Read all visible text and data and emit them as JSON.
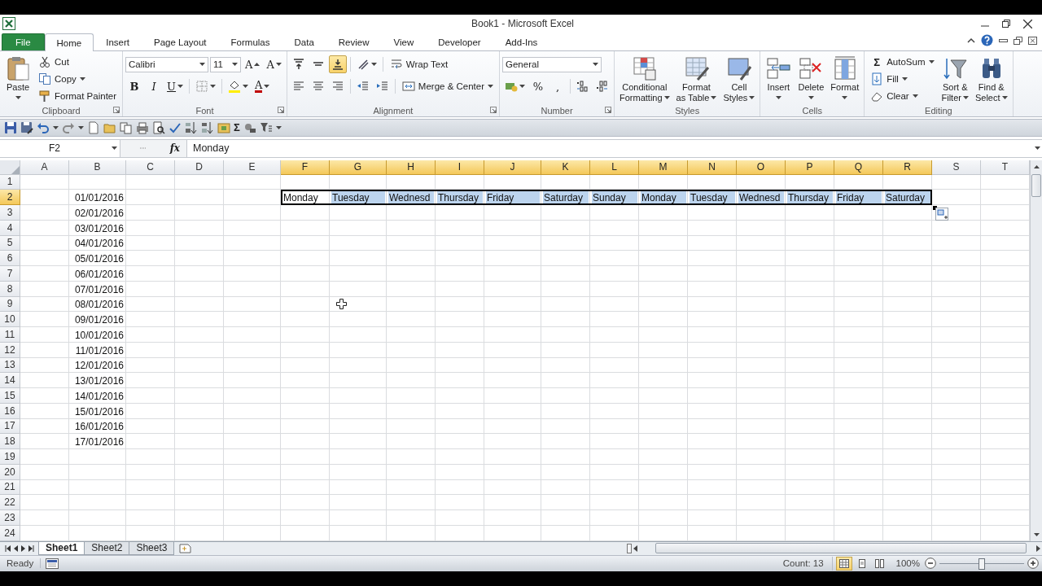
{
  "window": {
    "title": "Book1 - Microsoft Excel"
  },
  "tabs": [
    {
      "label": "File",
      "kind": "file",
      "selected": false
    },
    {
      "label": "Home",
      "kind": "tab",
      "selected": true
    },
    {
      "label": "Insert",
      "kind": "tab",
      "selected": false
    },
    {
      "label": "Page Layout",
      "kind": "tab",
      "selected": false
    },
    {
      "label": "Formulas",
      "kind": "tab",
      "selected": false
    },
    {
      "label": "Data",
      "kind": "tab",
      "selected": false
    },
    {
      "label": "Review",
      "kind": "tab",
      "selected": false
    },
    {
      "label": "View",
      "kind": "tab",
      "selected": false
    },
    {
      "label": "Developer",
      "kind": "tab",
      "selected": false
    },
    {
      "label": "Add-Ins",
      "kind": "tab",
      "selected": false
    }
  ],
  "ribbon": {
    "groups": [
      {
        "label": "Clipboard",
        "launcher": true,
        "items": [
          {
            "kind": "large",
            "lines": [
              "Paste"
            ],
            "dropdown": true
          },
          {
            "kind": "stack",
            "items": [
              {
                "kind": "small",
                "label": "Cut",
                "dropdown": false
              },
              {
                "kind": "small",
                "label": "Copy",
                "dropdown": true
              },
              {
                "kind": "small",
                "label": "Format Painter",
                "dropdown": false
              }
            ]
          }
        ]
      },
      {
        "label": "Font",
        "launcher": true,
        "items": [
          {
            "kind": "rows",
            "rows": [
              {
                "items": [
                  {
                    "kind": "combo",
                    "value": "Calibri"
                  },
                  {
                    "kind": "combo",
                    "value": "11"
                  },
                  {
                    "kind": "tool",
                    "text": "A",
                    "dropdown": false
                  },
                  {
                    "kind": "tool",
                    "text": "A",
                    "dropdown": false
                  }
                ]
              },
              {
                "items": [
                  {
                    "kind": "tool",
                    "text": "B",
                    "dropdown": false
                  },
                  {
                    "kind": "tool",
                    "text": "I",
                    "dropdown": false
                  },
                  {
                    "kind": "tool",
                    "text": "U",
                    "dropdown": true
                  },
                  {
                    "kind": "separator"
                  },
                  {
                    "kind": "tool",
                    "dropdown": true
                  },
                  {
                    "kind": "separator"
                  },
                  {
                    "kind": "tool",
                    "dropdown": true
                  },
                  {
                    "kind": "tool",
                    "text": "A",
                    "dropdown": true
                  }
                ]
              }
            ]
          }
        ]
      },
      {
        "label": "Alignment",
        "launcher": true,
        "items": [
          {
            "kind": "rows",
            "rows": [
              {
                "items": [
                  {
                    "kind": "tool",
                    "dropdown": false,
                    "selected": false
                  },
                  {
                    "kind": "tool",
                    "dropdown": false,
                    "selected": false
                  },
                  {
                    "kind": "tool",
                    "dropdown": false,
                    "selected": true
                  },
                  {
                    "kind": "separator"
                  },
                  {
                    "kind": "tool",
                    "dropdown": true
                  },
                  {
                    "kind": "separator"
                  },
                  {
                    "kind": "small",
                    "label": "Wrap Text",
                    "dropdown": false
                  }
                ]
              },
              {
                "items": [
                  {
                    "kind": "tool",
                    "dropdown": false
                  },
                  {
                    "kind": "tool",
                    "dropdown": false
                  },
                  {
                    "kind": "tool",
                    "dropdown": false
                  },
                  {
                    "kind": "separator"
                  },
                  {
                    "kind": "tool",
                    "dropdown": false
                  },
                  {
                    "kind": "tool",
                    "dropdown": false
                  },
                  {
                    "kind": "separator"
                  },
                  {
                    "kind": "small",
                    "label": "Merge & Center",
                    "dropdown": true
                  }
                ]
              }
            ]
          }
        ]
      },
      {
        "label": "Number",
        "launcher": true,
        "items": [
          {
            "kind": "rows",
            "rows": [
              {
                "items": [
                  {
                    "kind": "combo",
                    "value": "General"
                  }
                ]
              },
              {
                "items": [
                  {
                    "kind": "tool",
                    "dropdown": true
                  },
                  {
                    "kind": "tool",
                    "text": "%",
                    "dropdown": false
                  },
                  {
                    "kind": "tool",
                    "text": ",",
                    "dropdown": false
                  },
                  {
                    "kind": "separator"
                  },
                  {
                    "kind": "tool",
                    "dropdown": false
                  },
                  {
                    "kind": "tool",
                    "dropdown": false
                  }
                ]
              }
            ]
          }
        ]
      },
      {
        "label": "Styles",
        "launcher": false,
        "items": [
          {
            "kind": "large",
            "lines": [
              "Conditional",
              "Formatting"
            ],
            "dropdown": true
          },
          {
            "kind": "large",
            "lines": [
              "Format",
              "as Table"
            ],
            "dropdown": true
          },
          {
            "kind": "large",
            "lines": [
              "Cell",
              "Styles"
            ],
            "dropdown": true
          }
        ]
      },
      {
        "label": "Cells",
        "launcher": false,
        "items": [
          {
            "kind": "large",
            "lines": [
              "Insert"
            ],
            "dropdown": true
          },
          {
            "kind": "large",
            "lines": [
              "Delete"
            ],
            "dropdown": true
          },
          {
            "kind": "large",
            "lines": [
              "Format"
            ],
            "dropdown": true
          }
        ]
      },
      {
        "label": "Editing",
        "launcher": false,
        "items": [
          {
            "kind": "stack",
            "items": [
              {
                "kind": "small",
                "symbol": "Σ",
                "label": "AutoSum",
                "dropdown": true
              },
              {
                "kind": "small",
                "label": "Fill",
                "dropdown": true
              },
              {
                "kind": "small",
                "label": "Clear",
                "dropdown": true
              }
            ]
          },
          {
            "kind": "large",
            "lines": [
              "Sort &",
              "Filter"
            ],
            "dropdown": true
          },
          {
            "kind": "large",
            "lines": [
              "Find &",
              "Select"
            ],
            "dropdown": true
          }
        ]
      }
    ]
  },
  "quick_access": {
    "sum_symbol": "Σ"
  },
  "formula_bar": {
    "name_box": "F2",
    "function_label": "fx",
    "value": "Monday"
  },
  "sheet": {
    "columns": [
      {
        "label": "A",
        "selected": false
      },
      {
        "label": "B",
        "selected": false
      },
      {
        "label": "C",
        "selected": false
      },
      {
        "label": "D",
        "selected": false
      },
      {
        "label": "E",
        "selected": false
      },
      {
        "label": "F",
        "selected": true
      },
      {
        "label": "G",
        "selected": true
      },
      {
        "label": "H",
        "selected": true
      },
      {
        "label": "I",
        "selected": true
      },
      {
        "label": "J",
        "selected": true
      },
      {
        "label": "K",
        "selected": true
      },
      {
        "label": "L",
        "selected": true
      },
      {
        "label": "M",
        "selected": true
      },
      {
        "label": "N",
        "selected": true
      },
      {
        "label": "O",
        "selected": true
      },
      {
        "label": "P",
        "selected": true
      },
      {
        "label": "Q",
        "selected": true
      },
      {
        "label": "R",
        "selected": true
      },
      {
        "label": "S",
        "selected": false
      },
      {
        "label": "T",
        "selected": false
      }
    ],
    "rows": [
      {
        "number": "1",
        "selected": false
      },
      {
        "number": "2",
        "selected": true,
        "cells": [
          null,
          {
            "kind": "date",
            "text": "01/01/2016",
            "selected": false,
            "active": false
          },
          null,
          null,
          null,
          {
            "kind": "text",
            "text": "Monday",
            "selected": true,
            "active": true
          },
          {
            "kind": "text",
            "text": "Tuesday",
            "selected": true,
            "active": false
          },
          {
            "kind": "text",
            "text": "Wednesd",
            "selected": true,
            "active": false
          },
          {
            "kind": "text",
            "text": "Thursday",
            "selected": true,
            "active": false
          },
          {
            "kind": "text",
            "text": "Friday",
            "selected": true,
            "active": false
          },
          {
            "kind": "text",
            "text": "Saturday",
            "selected": true,
            "active": false
          },
          {
            "kind": "text",
            "text": "Sunday",
            "selected": true,
            "active": false
          },
          {
            "kind": "text",
            "text": "Monday",
            "selected": true,
            "active": false
          },
          {
            "kind": "text",
            "text": "Tuesday",
            "selected": true,
            "active": false
          },
          {
            "kind": "text",
            "text": "Wednesd",
            "selected": true,
            "active": false
          },
          {
            "kind": "text",
            "text": "Thursday",
            "selected": true,
            "active": false
          },
          {
            "kind": "text",
            "text": "Friday",
            "selected": true,
            "active": false
          },
          {
            "kind": "text",
            "text": "Saturday",
            "selected": true,
            "active": false
          }
        ]
      },
      {
        "number": "3",
        "selected": false,
        "cells": [
          null,
          {
            "kind": "date",
            "text": "02/01/2016",
            "selected": false,
            "active": false
          }
        ]
      },
      {
        "number": "4",
        "selected": false,
        "cells": [
          null,
          {
            "kind": "date",
            "text": "03/01/2016",
            "selected": false,
            "active": false
          }
        ]
      },
      {
        "number": "5",
        "selected": false,
        "cells": [
          null,
          {
            "kind": "date",
            "text": "04/01/2016",
            "selected": false,
            "active": false
          }
        ]
      },
      {
        "number": "6",
        "selected": false,
        "cells": [
          null,
          {
            "kind": "date",
            "text": "05/01/2016",
            "selected": false,
            "active": false
          }
        ]
      },
      {
        "number": "7",
        "selected": false,
        "cells": [
          null,
          {
            "kind": "date",
            "text": "06/01/2016",
            "selected": false,
            "active": false
          }
        ]
      },
      {
        "number": "8",
        "selected": false,
        "cells": [
          null,
          {
            "kind": "date",
            "text": "07/01/2016",
            "selected": false,
            "active": false
          }
        ]
      },
      {
        "number": "9",
        "selected": false,
        "cells": [
          null,
          {
            "kind": "date",
            "text": "08/01/2016",
            "selected": false,
            "active": false
          }
        ]
      },
      {
        "number": "10",
        "selected": false,
        "cells": [
          null,
          {
            "kind": "date",
            "text": "09/01/2016",
            "selected": false,
            "active": false
          }
        ]
      },
      {
        "number": "11",
        "selected": false,
        "cells": [
          null,
          {
            "kind": "date",
            "text": "10/01/2016",
            "selected": false,
            "active": false
          }
        ]
      },
      {
        "number": "12",
        "selected": false,
        "cells": [
          null,
          {
            "kind": "date",
            "text": "11/01/2016",
            "selected": false,
            "active": false
          }
        ]
      },
      {
        "number": "13",
        "selected": false,
        "cells": [
          null,
          {
            "kind": "date",
            "text": "12/01/2016",
            "selected": false,
            "active": false
          }
        ]
      },
      {
        "number": "14",
        "selected": false,
        "cells": [
          null,
          {
            "kind": "date",
            "text": "13/01/2016",
            "selected": false,
            "active": false
          }
        ]
      },
      {
        "number": "15",
        "selected": false,
        "cells": [
          null,
          {
            "kind": "date",
            "text": "14/01/2016",
            "selected": false,
            "active": false
          }
        ]
      },
      {
        "number": "16",
        "selected": false,
        "cells": [
          null,
          {
            "kind": "date",
            "text": "15/01/2016",
            "selected": false,
            "active": false
          }
        ]
      },
      {
        "number": "17",
        "selected": false,
        "cells": [
          null,
          {
            "kind": "date",
            "text": "16/01/2016",
            "selected": false,
            "active": false
          }
        ]
      },
      {
        "number": "18",
        "selected": false,
        "cells": [
          null,
          {
            "kind": "date",
            "text": "17/01/2016",
            "selected": false,
            "active": false
          }
        ]
      },
      {
        "number": "19",
        "selected": false
      },
      {
        "number": "20",
        "selected": false
      },
      {
        "number": "21",
        "selected": false
      },
      {
        "number": "22",
        "selected": false
      },
      {
        "number": "23",
        "selected": false
      },
      {
        "number": "24",
        "selected": false
      }
    ]
  },
  "sheet_tabs": [
    {
      "label": "Sheet1",
      "selected": true
    },
    {
      "label": "Sheet2",
      "selected": false
    },
    {
      "label": "Sheet3",
      "selected": false
    }
  ],
  "status_bar": {
    "mode": "Ready",
    "summary": "Count: 13",
    "views": [
      {
        "selected": true
      },
      {
        "selected": false
      },
      {
        "selected": false
      }
    ],
    "zoom": "100%",
    "zoom_slider": {
      "level": 0.5
    }
  }
}
